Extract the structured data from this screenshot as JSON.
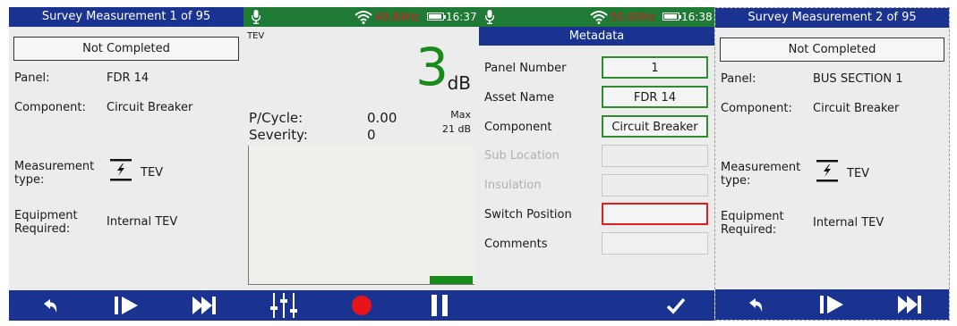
{
  "left_panel": {
    "title": "Survey Measurement 1 of 95",
    "status": "Not Completed",
    "panel_label": "Panel:",
    "panel_value": "FDR 14",
    "component_label": "Component:",
    "component_value": "Circuit Breaker",
    "measurement_label_1": "Measurement",
    "measurement_label_2": "type:",
    "measurement_value": "TEV",
    "equipment_label_1": "Equipment",
    "equipment_label_2": "Required:",
    "equipment_value": "Internal TEV"
  },
  "tev_panel": {
    "frequency": "49.84Hz",
    "time": "16:37",
    "mode_label": "TEV",
    "reading_value": "3",
    "reading_unit": "dB",
    "pcycle_label": "P/Cycle:",
    "pcycle_value": "0.00",
    "severity_label": "Severity:",
    "severity_value": "0",
    "max_label": "Max",
    "max_value": "21 dB",
    "level_fraction": 0.06
  },
  "metadata_panel": {
    "frequency": "50.00Hz",
    "time": "16:38",
    "title": "Metadata",
    "fields": [
      {
        "label": "Panel Number",
        "value": "1",
        "state": "ok"
      },
      {
        "label": "Asset Name",
        "value": "FDR 14",
        "state": "ok"
      },
      {
        "label": "Component",
        "value": "Circuit Breaker",
        "state": "ok"
      },
      {
        "label": "Sub Location",
        "value": "",
        "state": "disabled"
      },
      {
        "label": "Insulation",
        "value": "",
        "state": "disabled"
      },
      {
        "label": "Switch Position",
        "value": "",
        "state": "error"
      },
      {
        "label": "Comments",
        "value": "",
        "state": "empty"
      }
    ]
  },
  "right_panel": {
    "title": "Survey Measurement 2 of 95",
    "status": "Not Completed",
    "panel_label": "Panel:",
    "panel_value": "BUS SECTION 1",
    "component_label": "Component:",
    "component_value": "Circuit Breaker",
    "measurement_label_1": "Measurement",
    "measurement_label_2": "type:",
    "measurement_value": "TEV",
    "equipment_label_1": "Equipment",
    "equipment_label_2": "Required:",
    "equipment_value": "Internal TEV"
  },
  "icons": {
    "back": "back-arrow-icon",
    "step_forward": "step-forward-icon",
    "skip_forward": "skip-forward-icon",
    "settings": "sliders-icon",
    "record": "record-icon",
    "pause": "pause-icon",
    "confirm": "checkmark-icon",
    "tev_type": "tev-sensor-icon",
    "mic": "microphone-icon",
    "wifi": "wifi-icon",
    "battery": "battery-icon"
  },
  "colors": {
    "header_blue": "#1a3290",
    "status_green": "#1f7a36",
    "reading_green": "#1a8a1a",
    "frequency_red": "#d41a1a",
    "record_red": "#e8141a",
    "error_red": "#e01e1e"
  }
}
